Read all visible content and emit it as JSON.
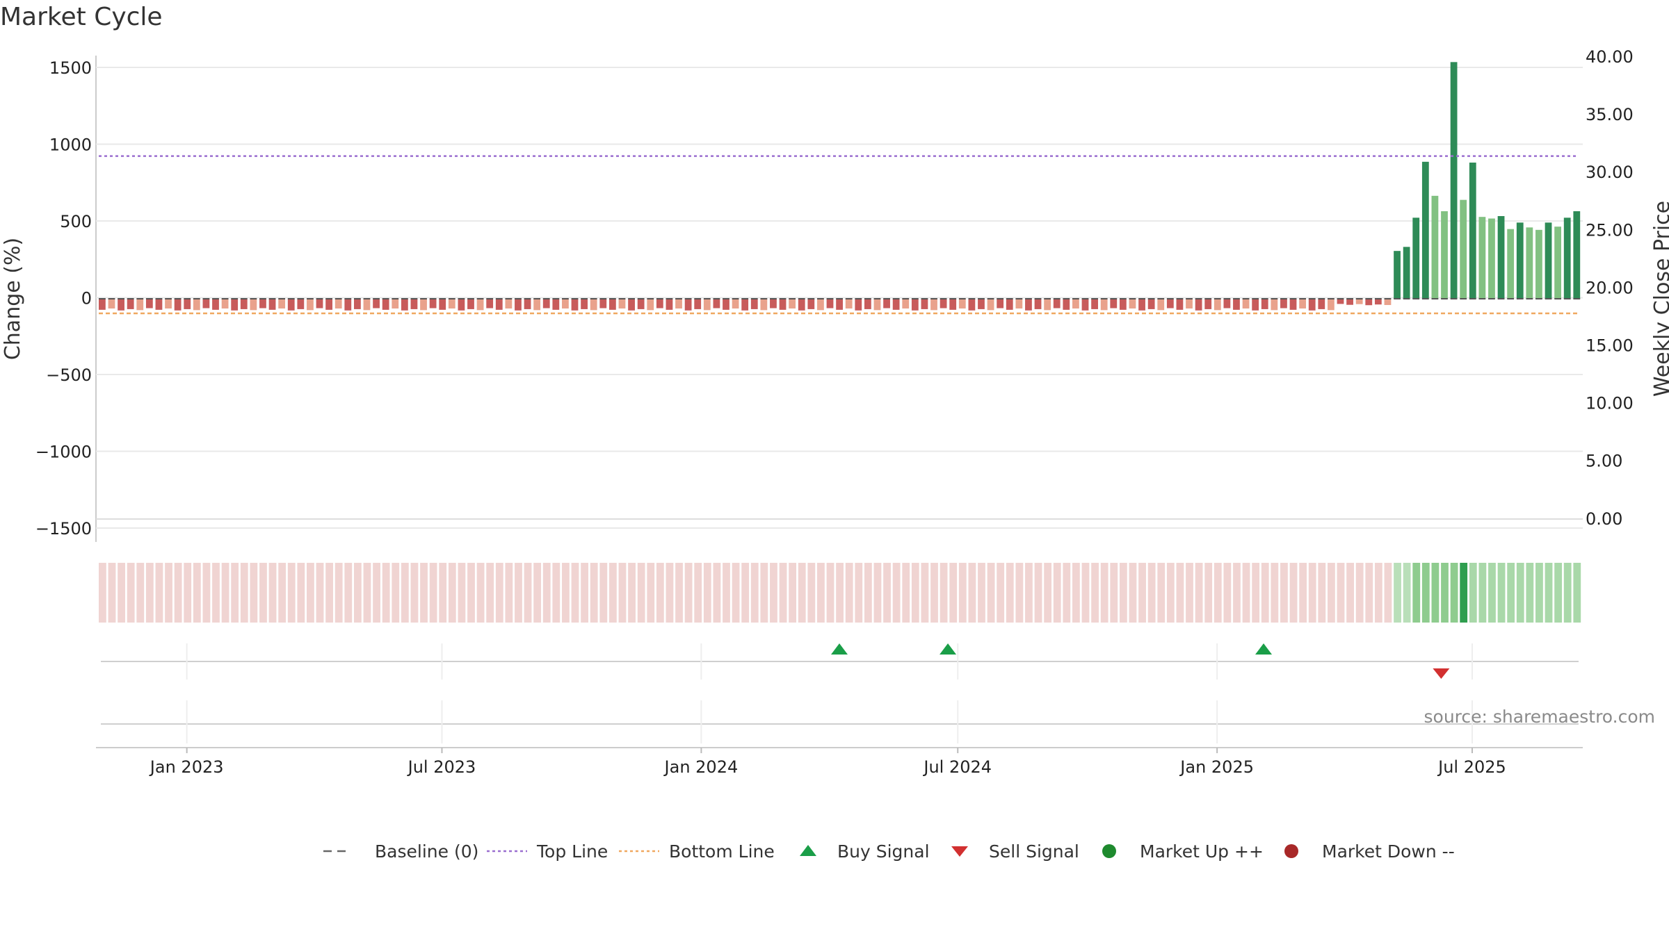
{
  "title": "Market Cycle",
  "source": "source: sharemaestro.com",
  "colors": {
    "down_dark": "#c85b5b",
    "down_light": "#e9a28c",
    "up_dark": "#2e8b57",
    "up_light": "#82c182",
    "top_line": "#9b6fd0",
    "bottom_line": "#f0a860",
    "buy": "#1a9e48",
    "sell": "#d23030",
    "market_up": "#1e8a2e",
    "market_down": "#a82828",
    "baseline": "#666666"
  },
  "chart_data": {
    "type": "bar",
    "title": "Market Cycle",
    "ylabel": "Change (%)",
    "y2label": "Weekly Close Price",
    "ylim": [
      -1500,
      1500
    ],
    "y2lim": [
      0,
      40
    ],
    "yticks": [
      "1500",
      "1000",
      "500",
      "0",
      "−500",
      "−1000",
      "−1500"
    ],
    "y2ticks": [
      "40.00",
      "35.00",
      "30.00",
      "25.00",
      "20.00",
      "15.00",
      "10.00",
      "5.00",
      "0.00"
    ],
    "xticks": [
      "Jan 2023",
      "Jul 2023",
      "Jan 2024",
      "Jul 2024",
      "Jan 2025",
      "Jul 2025"
    ],
    "x_start": "2022-10-31",
    "x_end": "2025-09-15",
    "top_line": 880,
    "bottom_line": -90,
    "baseline": 0,
    "weekly_close_price": 20,
    "grid": true,
    "down_weeks": 137,
    "down_change_pattern": [
      -68,
      -60,
      -72,
      -64,
      -70,
      -58
    ],
    "up_change": [
      295,
      320,
      500,
      845,
      635,
      540,
      1460,
      610,
      840,
      505,
      495,
      510,
      430,
      470,
      440,
      425,
      470,
      445,
      500,
      540
    ],
    "signals": [
      {
        "type": "buy",
        "date": "2024-04-08"
      },
      {
        "type": "buy",
        "date": "2024-06-24"
      },
      {
        "type": "buy",
        "date": "2025-02-03"
      },
      {
        "type": "sell",
        "date": "2025-06-09"
      }
    ],
    "legend": [
      {
        "label": "Baseline (0)",
        "marker": "dash"
      },
      {
        "label": "Top Line",
        "marker": "dotted"
      },
      {
        "label": "Bottom Line",
        "marker": "dotted"
      },
      {
        "label": "Buy Signal",
        "marker": "triangle-up"
      },
      {
        "label": "Sell Signal",
        "marker": "triangle-down"
      },
      {
        "label": "Market Up ++",
        "marker": "circle"
      },
      {
        "label": "Market Down --",
        "marker": "circle"
      }
    ],
    "legend_position": "bottom"
  }
}
